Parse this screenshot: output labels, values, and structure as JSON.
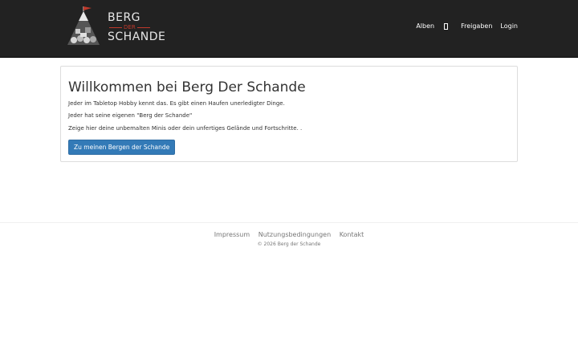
{
  "brand": {
    "top": "BERG",
    "middle": "DER",
    "bottom": "SCHANDE"
  },
  "nav": {
    "albums": "Alben",
    "shares": "Freigaben",
    "login": "Login",
    "icon": "missing-glyph-icon"
  },
  "main": {
    "title": "Willkommen bei Berg Der Schande",
    "lines": [
      "Jeder im Tabletop Hobby kennt das. Es gibt einen Haufen unerledigter Dinge.",
      "Jeder hat seine eigenen \"Berg der Schande\"",
      "Zeige hier deine unbemalten Minis oder dein unfertiges Gelände und Fortschritte. ."
    ],
    "cta": "Zu meinen Bergen der Schande"
  },
  "footer": {
    "links": [
      "Impressum",
      "Nutzungsbedingungen",
      "Kontakt"
    ],
    "copyright": "© 2026 Berg der Schande"
  },
  "colors": {
    "navbar_bg": "#222222",
    "primary": "#337ab7",
    "accent": "#c0392b"
  }
}
